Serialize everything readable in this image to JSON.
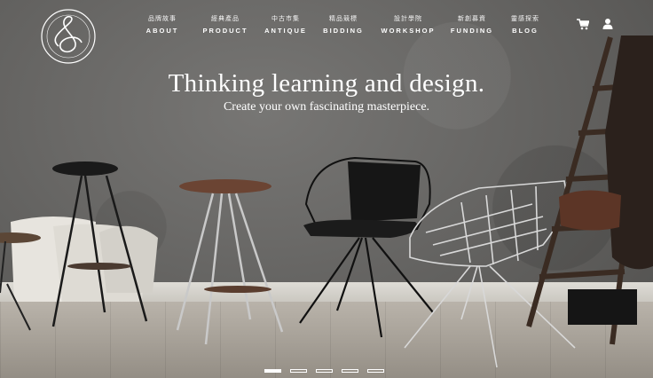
{
  "brand": {
    "logo_icon": "brand-monogram-emblem"
  },
  "nav": {
    "items": [
      {
        "zh": "品牌故事",
        "en": "ABOUT"
      },
      {
        "zh": "經典產品",
        "en": "PRODUCT"
      },
      {
        "zh": "中古市集",
        "en": "ANTIQUE"
      },
      {
        "zh": "精品競標",
        "en": "BIDDING"
      },
      {
        "zh": "設計學院",
        "en": "WORKSHOP"
      },
      {
        "zh": "新創募資",
        "en": "FUNDING"
      },
      {
        "zh": "靈感探索",
        "en": "BLOG"
      }
    ]
  },
  "header_actions": {
    "cart_icon": "cart-icon",
    "user_icon": "user-icon"
  },
  "hero": {
    "title": "Thinking learning and design.",
    "subtitle": "Create your own fascinating masterpiece."
  },
  "slider": {
    "count": 5,
    "active_index": 0
  },
  "colors": {
    "text": "#ffffff",
    "wall": "#6a6967",
    "floor": "#a39d94"
  }
}
